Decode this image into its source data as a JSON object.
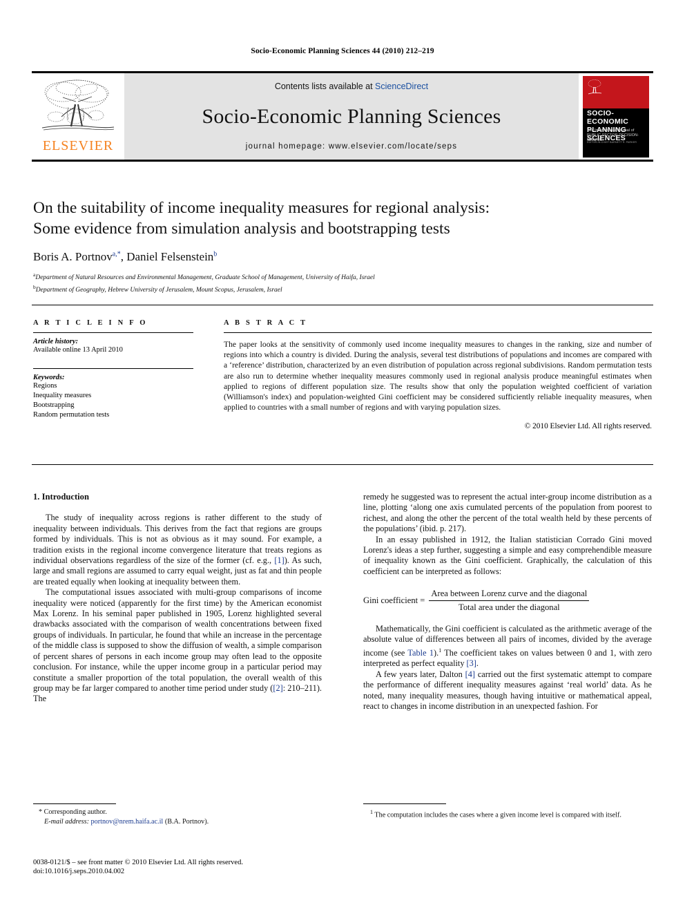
{
  "running_head": "Socio-Economic Planning Sciences 44 (2010) 212–219",
  "masthead": {
    "contents_prefix": "Contents lists available at ",
    "sciencedirect": "ScienceDirect",
    "journal_title": "Socio-Economic Planning Sciences",
    "homepage": "journal homepage: www.elsevier.com/locate/seps",
    "publisher": "ELSEVIER",
    "cover": {
      "line1": "SOCIO-ECONOMIC",
      "line2": "PLANNING SCIENCES",
      "subtitle": "The International Journal of PUBLIC SECTOR DECISION-MAKING",
      "editors": "EDITOR-IN-CHIEF BARNETT R. PARKER"
    },
    "colors": {
      "sciencedirect_blue": "#1a4fa0",
      "elsevier_orange": "#F58220",
      "cover_red": "#c4161c"
    }
  },
  "article": {
    "title_line1": "On the suitability of income inequality measures for regional analysis:",
    "title_line2": "Some evidence from simulation analysis and bootstrapping tests",
    "author1": "Boris A. Portnov",
    "author1_sup": "a,*",
    "author_sep": ", ",
    "author2": "Daniel Felsenstein",
    "author2_sup": "b",
    "affiliation_a_sup": "a",
    "affiliation_a": "Department of Natural Resources and Environmental Management, Graduate School of Management, University of Haifa, Israel",
    "affiliation_b_sup": "b",
    "affiliation_b": "Department of Geography, Hebrew University of Jerusalem, Mount Scopus, Jerusalem, Israel"
  },
  "article_info": {
    "heading": "A R T I C L E   I N F O",
    "history_label": "Article history:",
    "history_value": "Available online 13 April 2010",
    "keywords_label": "Keywords:",
    "keywords": [
      "Regions",
      "Inequality measures",
      "Bootstrapping",
      "Random permutation tests"
    ]
  },
  "abstract": {
    "heading": "A B S T R A C T",
    "text": "The paper looks at the sensitivity of commonly used income inequality measures to changes in the ranking, size and number of regions into which a country is divided. During the analysis, several test distributions of populations and incomes are compared with a ‘reference’ distribution, characterized by an even distribution of population across regional subdivisions. Random permutation tests are also run to determine whether inequality measures commonly used in regional analysis produce meaningful estimates when applied to regions of different population size. The results show that only the population weighted coefficient of variation (Williamson's index) and population-weighted Gini coefficient may be considered sufficiently reliable inequality measures, when applied to countries with a small number of regions and with varying population sizes.",
    "copyright": "© 2010 Elsevier Ltd. All rights reserved."
  },
  "body": {
    "section_heading": "1. Introduction",
    "left": {
      "p1_a": "The study of inequality across regions is rather different to the study of inequality between individuals. This derives from the fact that regions are groups formed by individuals. This is not as obvious as it may sound. For example, a tradition exists in the regional income convergence literature that treats regions as individual observations regardless of the size of the former (cf. e.g., ",
      "p1_ref": "[1]",
      "p1_b": "). As such, large and small regions are assumed to carry equal weight, just as fat and thin people are treated equally when looking at inequality between them.",
      "p2_a": "The computational issues associated with multi-group comparisons of income inequality were noticed (apparently for the first time) by the American economist Max Lorenz. In his seminal paper published in 1905, Lorenz highlighted several drawbacks associated with the comparison of wealth concentrations between fixed groups of individuals. In particular, he found that while an increase in the percentage of the middle class is supposed to show the diffusion of wealth, a simple comparison of percent shares of persons in each income group may often lead to the opposite conclusion. For instance, while the upper income group in a particular period may constitute a smaller proportion of the total population, the overall wealth of this group may be far larger compared to another time period under study (",
      "p2_ref": "[2]",
      "p2_b": ": 210–211). The"
    },
    "right": {
      "p1": "remedy he suggested was to represent the actual inter-group income distribution as a line, plotting ‘along one axis cumulated percents of the population from poorest to richest, and along the other the percent of the total wealth held by these percents of the populations’ (ibid. p. 217).",
      "p2": "In an essay published in 1912, the Italian statistician Corrado Gini moved Lorenz's ideas a step further, suggesting a simple and easy comprehendible measure of inequality known as the Gini coefficient. Graphically, the calculation of this coefficient can be interpreted as follows:",
      "formula_lhs": "Gini coefficient =",
      "formula_num": "Area between Lorenz curve and the diagonal",
      "formula_den": "Total area under the diagonal",
      "p3_a": "Mathematically, the Gini coefficient is calculated as the arithmetic average of the absolute value of differences between all pairs of incomes, divided by the average income (see ",
      "p3_table_ref": "Table 1",
      "p3_b": ").",
      "p3_fn": "1",
      "p3_c": " The coefficient takes on values between 0 and 1, with zero interpreted as perfect equality ",
      "p3_ref": "[3]",
      "p3_d": ".",
      "p4_a": "A few years later, Dalton ",
      "p4_ref": "[4]",
      "p4_b": " carried out the first systematic attempt to compare the performance of different inequality measures against ‘real world’ data. As he noted, many inequality measures, though having intuitive or mathematical appeal, react to changes in income distribution in an unexpected fashion. For"
    }
  },
  "footnotes": {
    "left": {
      "corresponding": "* Corresponding author.",
      "email_label": "E-mail address:",
      "email": "portnov@nrem.haifa.ac.il",
      "email_tail": " (B.A. Portnov)."
    },
    "right": {
      "marker": "1",
      "text": "The computation includes the cases where a given income level is compared with itself."
    }
  },
  "imprint": {
    "issn_line": "0038-0121/$ – see front matter © 2010 Elsevier Ltd. All rights reserved.",
    "doi_line": "doi:10.1016/j.seps.2010.04.002"
  }
}
